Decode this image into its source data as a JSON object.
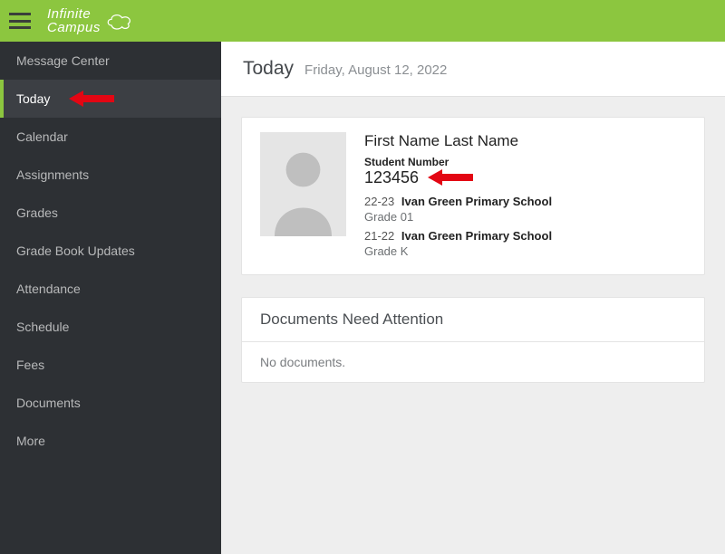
{
  "brand": {
    "line1": "Infinite",
    "line2": "Campus"
  },
  "sidebar": {
    "items": [
      {
        "label": "Message Center",
        "active": false
      },
      {
        "label": "Today",
        "active": true
      },
      {
        "label": "Calendar",
        "active": false
      },
      {
        "label": "Assignments",
        "active": false
      },
      {
        "label": "Grades",
        "active": false
      },
      {
        "label": "Grade Book Updates",
        "active": false
      },
      {
        "label": "Attendance",
        "active": false
      },
      {
        "label": "Schedule",
        "active": false
      },
      {
        "label": "Fees",
        "active": false
      },
      {
        "label": "Documents",
        "active": false
      },
      {
        "label": "More",
        "active": false
      }
    ]
  },
  "page": {
    "title": "Today",
    "date": "Friday, August 12, 2022"
  },
  "student": {
    "name": "First Name  Last Name",
    "number_label": "Student Number",
    "number": "123456",
    "enrollments": [
      {
        "years": "22-23",
        "school": "Ivan Green Primary School",
        "grade": "Grade 01"
      },
      {
        "years": "21-22",
        "school": "Ivan Green Primary School",
        "grade": "Grade K"
      }
    ]
  },
  "documents": {
    "header": "Documents Need Attention",
    "empty": "No documents."
  },
  "colors": {
    "accent": "#8cc63f",
    "arrow": "#e30613"
  }
}
